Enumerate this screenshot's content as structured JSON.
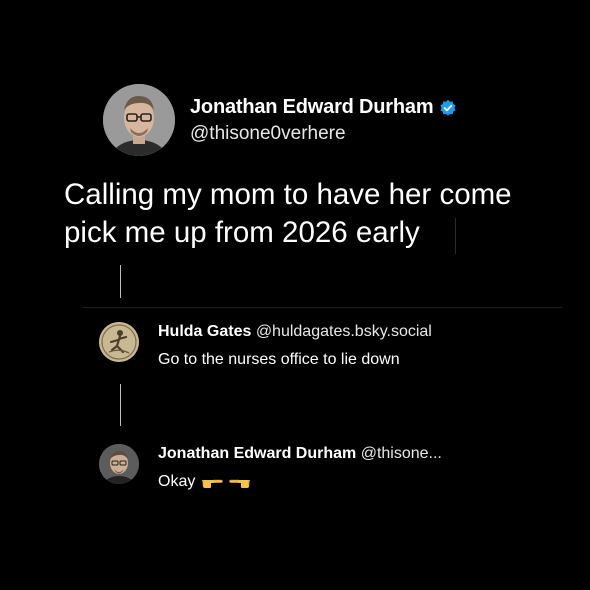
{
  "post": {
    "author_name": "Jonathan Edward Durham",
    "author_handle": "@thisone0verhere",
    "text": "Calling my mom to have her come pick me up from 2026 early",
    "verified_icon": "verified-badge-icon",
    "accent_color": "#1d9bf0"
  },
  "replies": [
    {
      "author_name": "Hulda Gates",
      "author_handle": "@huldagates.bsky.social",
      "text": "Go to the nurses office to lie down"
    },
    {
      "author_name": "Jonathan Edward Durham",
      "author_handle": "@thisone...",
      "text": "Okay",
      "emojis": [
        "pointing-right-hand-icon",
        "pointing-left-hand-icon"
      ]
    }
  ]
}
